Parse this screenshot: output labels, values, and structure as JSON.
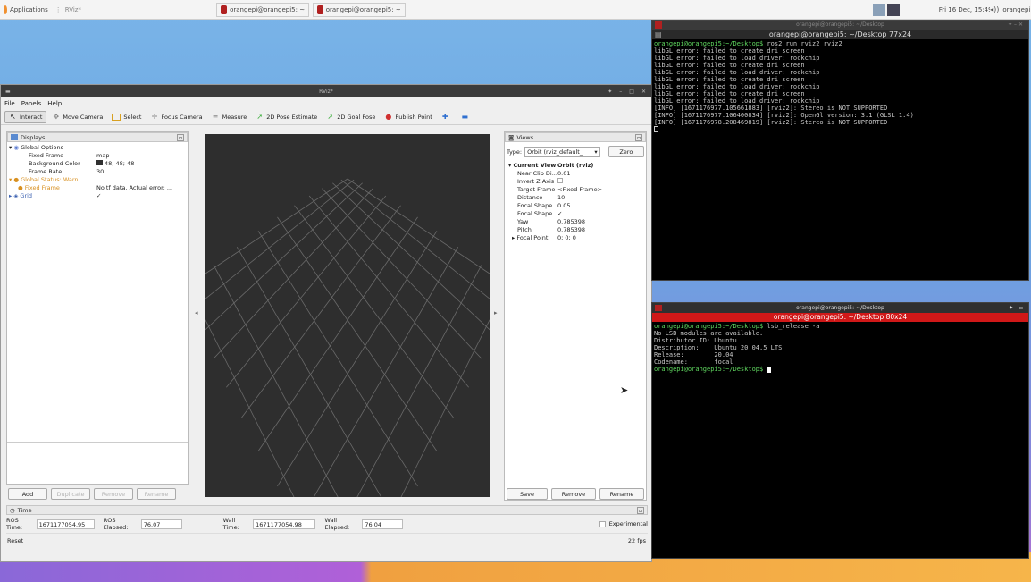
{
  "topbar": {
    "applications": "Applications",
    "tasks": [
      "RViz*",
      "orangepi@orangepi5: ~",
      "orangepi@orangepi5: ~"
    ],
    "clock": "Fri 16 Dec, 15:49",
    "user": "orangepi"
  },
  "rviz": {
    "title": "RViz*",
    "menu": [
      "File",
      "Panels",
      "Help"
    ],
    "tools": [
      "Interact",
      "Move Camera",
      "Select",
      "Focus Camera",
      "Measure",
      "2D Pose Estimate",
      "2D Goal Pose",
      "Publish Point"
    ],
    "displays": {
      "header": "Displays",
      "rows": [
        {
          "k": "Global Options",
          "v": "",
          "indent": 0
        },
        {
          "k": "Fixed Frame",
          "v": "map",
          "indent": 2
        },
        {
          "k": "Background Color",
          "v": "48; 48; 48",
          "indent": 2
        },
        {
          "k": "Frame Rate",
          "v": "30",
          "indent": 2
        },
        {
          "k": "Global Status: Warn",
          "v": "",
          "indent": 0
        },
        {
          "k": "Fixed Frame",
          "v": "No tf data.  Actual error: ...",
          "indent": 2
        },
        {
          "k": "Grid",
          "v": "✓",
          "indent": 0
        }
      ],
      "buttons": [
        "Add",
        "Duplicate",
        "Remove",
        "Rename"
      ]
    },
    "views": {
      "header": "Views",
      "type_label": "Type:",
      "type_value": "Orbit (rviz_default_",
      "zero": "Zero",
      "rows": [
        {
          "k": "Current View",
          "v": "Orbit (rviz)"
        },
        {
          "k": "Near Clip Di...",
          "v": "0.01"
        },
        {
          "k": "Invert Z Axis",
          "v": ""
        },
        {
          "k": "Target Frame",
          "v": "<Fixed Frame>"
        },
        {
          "k": "Distance",
          "v": "10"
        },
        {
          "k": "Focal Shape...",
          "v": "0.05"
        },
        {
          "k": "Focal Shape...",
          "v": "✓"
        },
        {
          "k": "Yaw",
          "v": "0.785398"
        },
        {
          "k": "Pitch",
          "v": "0.785398"
        },
        {
          "k": "Focal Point",
          "v": "0; 0; 0"
        }
      ],
      "buttons": [
        "Save",
        "Remove",
        "Rename"
      ]
    },
    "time": {
      "header": "Time",
      "ros_time_label": "ROS Time:",
      "ros_time": "1671177054.95",
      "ros_elapsed_label": "ROS Elapsed:",
      "ros_elapsed": "76.07",
      "wall_time_label": "Wall Time:",
      "wall_time": "1671177054.98",
      "wall_elapsed_label": "Wall Elapsed:",
      "wall_elapsed": "76.04",
      "experimental": "Experimental",
      "reset": "Reset",
      "fps": "22 fps"
    }
  },
  "term1": {
    "title": "orangepi@orangepi5: ~/Desktop",
    "tab": "orangepi@orangepi5: ~/Desktop 77x24",
    "prompt": "orangepi@orangepi5:~/Desktop$",
    "cmd": " ros2 run rviz2 rviz2",
    "lines": [
      "libGL error: failed to create dri screen",
      "libGL error: failed to load driver: rockchip",
      "libGL error: failed to create dri screen",
      "libGL error: failed to load driver: rockchip",
      "libGL error: failed to create dri screen",
      "libGL error: failed to load driver: rockchip",
      "libGL error: failed to create dri screen",
      "libGL error: failed to load driver: rockchip",
      "[INFO] [1671176977.105661883] [rviz2]: Stereo is NOT SUPPORTED",
      "[INFO] [1671176977.106400834] [rviz2]: OpenGl version: 3.1 (GLSL 1.4)",
      "[INFO] [1671176978.208469819] [rviz2]: Stereo is NOT SUPPORTED"
    ]
  },
  "term2": {
    "title": "orangepi@orangepi5: ~/Desktop",
    "tab": "orangepi@orangepi5: ~/Desktop 80x24",
    "prompt": "orangepi@orangepi5:~/Desktop$",
    "cmd": " lsb_release -a",
    "lines": [
      "No LSB modules are available.",
      "Distributor ID: Ubuntu",
      "Description:    Ubuntu 20.04.5 LTS",
      "Release:        20.04",
      "Codename:       focal"
    ]
  }
}
